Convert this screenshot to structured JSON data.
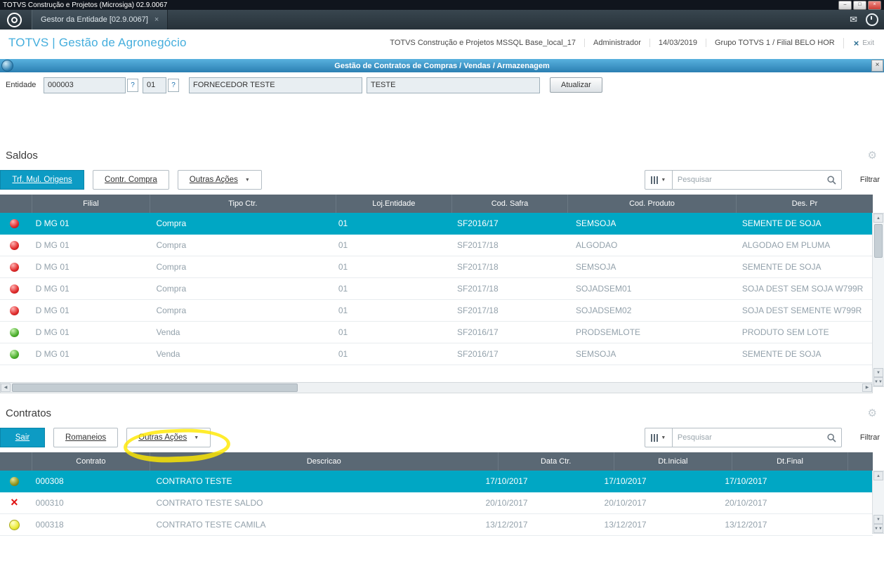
{
  "window": {
    "title": "TOTVS Construção e Projetos (Microsiga) 02.9.0067",
    "controls": {
      "minimize": "–",
      "maximize": "□",
      "close": "×"
    }
  },
  "tabbar": {
    "tab_label": "Gestor da Entidade [02.9.0067]",
    "tab_close": "×"
  },
  "appheader": {
    "brand": "TOTVS | Gestão de Agronegócio",
    "environment": "TOTVS Construção e Projetos MSSQL Base_local_17",
    "user": "Administrador",
    "date": "14/03/2019",
    "branch": "Grupo TOTVS 1 / Filial BELO HOR",
    "exit_x": "×",
    "exit_label": "Exit"
  },
  "dialog": {
    "title": "Gestão de Contratos de Compras / Vendas / Armazenagem",
    "close": "×"
  },
  "entity_form": {
    "label": "Entidade",
    "code": "000003",
    "lookup1": "?",
    "store": "01",
    "lookup2": "?",
    "name": "FORNECEDOR TESTE",
    "short_name": "TESTE",
    "refresh_button": "Atualizar"
  },
  "icons": {
    "gear": "⚙",
    "caret_down": "▼",
    "arrow_up": "▲",
    "arrow_down": "▼",
    "arrow_left": "◀",
    "arrow_right": "▶",
    "double_down": "▼▼",
    "mail": "✉"
  },
  "colors": {
    "primary_button": "#0d9bc4",
    "selected_row": "#00a7c4",
    "grid_header_bg": "#5a6874",
    "brand_blue": "#45aedd",
    "highlight_marker": "#ffe800"
  },
  "saldos": {
    "title": "Saldos",
    "buttons": {
      "primary": "Trf. Mul. Origens",
      "secondary1": "Contr. Compra",
      "secondary2": "Outras Ações"
    },
    "search_placeholder": "Pesquisar",
    "filter_label": "Filtrar",
    "columns": [
      "Filial",
      "Tipo Ctr.",
      "Loj.Entidade",
      "Cod. Safra",
      "Cod. Produto",
      "Des. Pr"
    ],
    "rows": [
      {
        "status": "st-red",
        "filial": "D MG 01",
        "tipo": "Compra",
        "loja": "01",
        "safra": "SF2016/17",
        "produto": "SEMSOJA",
        "descricao": "SEMENTE DE SOJA"
      },
      {
        "status": "st-red",
        "filial": "D MG 01",
        "tipo": "Compra",
        "loja": "01",
        "safra": "SF2017/18",
        "produto": "ALGODAO",
        "descricao": "ALGODAO EM PLUMA"
      },
      {
        "status": "st-red",
        "filial": "D MG 01",
        "tipo": "Compra",
        "loja": "01",
        "safra": "SF2017/18",
        "produto": "SEMSOJA",
        "descricao": "SEMENTE DE SOJA"
      },
      {
        "status": "st-red",
        "filial": "D MG 01",
        "tipo": "Compra",
        "loja": "01",
        "safra": "SF2017/18",
        "produto": "SOJADSEM01",
        "descricao": "SOJA DEST SEM SOJA W799R"
      },
      {
        "status": "st-red",
        "filial": "D MG 01",
        "tipo": "Compra",
        "loja": "01",
        "safra": "SF2017/18",
        "produto": "SOJADSEM02",
        "descricao": "SOJA DEST SEMENTE W799R"
      },
      {
        "status": "st-green",
        "filial": "D MG 01",
        "tipo": "Venda",
        "loja": "01",
        "safra": "SF2016/17",
        "produto": "PRODSEMLOTE",
        "descricao": "PRODUTO SEM LOTE"
      },
      {
        "status": "st-green",
        "filial": "D MG 01",
        "tipo": "Venda",
        "loja": "01",
        "safra": "SF2016/17",
        "produto": "SEMSOJA",
        "descricao": "SEMENTE DE SOJA"
      }
    ]
  },
  "contratos": {
    "title": "Contratos",
    "buttons": {
      "primary": "Sair",
      "secondary1": "Romaneios",
      "secondary2": "Outras Ações"
    },
    "search_placeholder": "Pesquisar",
    "filter_label": "Filtrar",
    "columns": [
      "Contrato",
      "Descricao",
      "Data Ctr.",
      "Dt.Inicial",
      "Dt.Final"
    ],
    "rows": [
      {
        "status": "st-olive",
        "contrato": "000308",
        "descricao": "CONTRATO TESTE",
        "data": "17/10/2017",
        "inicial": "17/10/2017",
        "final": "17/10/2017"
      },
      {
        "status": "st-redx",
        "contrato": "000310",
        "descricao": "CONTRATO TESTE SALDO",
        "data": "20/10/2017",
        "inicial": "20/10/2017",
        "final": "20/10/2017"
      },
      {
        "status": "st-yellow",
        "contrato": "000318",
        "descricao": "CONTRATO TESTE CAMILA",
        "data": "13/12/2017",
        "inicial": "13/12/2017",
        "final": "13/12/2017"
      }
    ]
  }
}
